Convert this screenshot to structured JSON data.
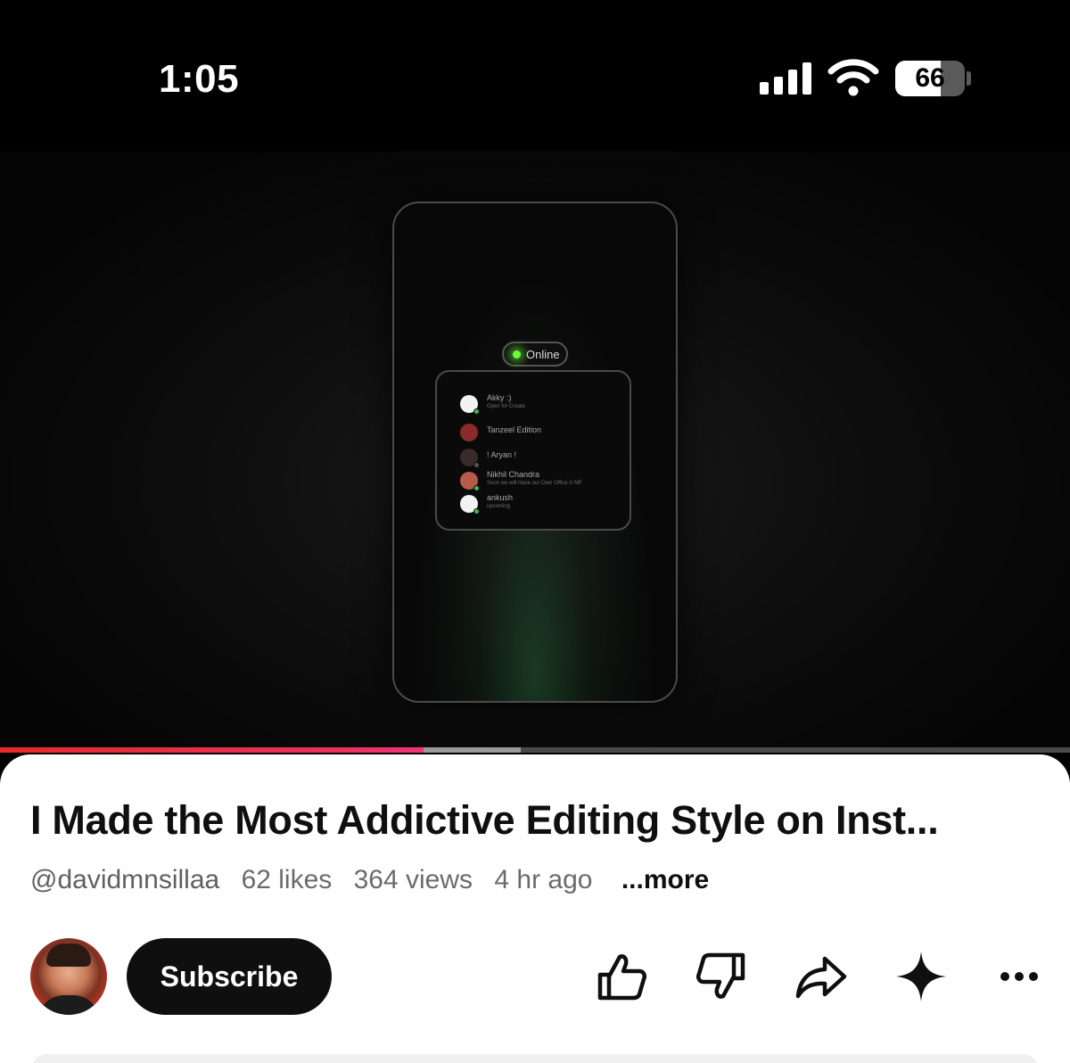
{
  "status_bar": {
    "time": "1:05",
    "battery_level": "66",
    "signal_icon": "cellular-signal-icon",
    "wifi_icon": "wifi-icon",
    "battery_icon": "battery-icon"
  },
  "video": {
    "online_label": "Online",
    "friends": [
      {
        "name": "Akky :)",
        "status": "Open for Create"
      },
      {
        "name": "Tanzeel Edition",
        "status": ""
      },
      {
        "name": "! Aryan !",
        "status": ""
      },
      {
        "name": "Nikhil Chandra",
        "status": "Soon we will Have our Own Office U MF"
      },
      {
        "name": "ankush",
        "status": "upcoming"
      }
    ],
    "progress_played": 0.396,
    "progress_buffered": 0.487
  },
  "info": {
    "title": "I Made the Most Addictive Editing Style on Inst...",
    "channel_handle": "@davidmnsillaa",
    "likes": "62 likes",
    "views": "364 views",
    "age": "4 hr ago",
    "more_label": "...more",
    "subscribe_label": "Subscribe"
  },
  "actions": [
    {
      "icon": "thumbs-up-icon"
    },
    {
      "icon": "thumbs-down-icon"
    },
    {
      "icon": "share-icon"
    },
    {
      "icon": "sparkle-icon"
    },
    {
      "icon": "more-options-icon"
    }
  ],
  "colors": {
    "progress_red": "#e62a2a",
    "progress_pink": "#f0357a",
    "online_green": "#6bff3a",
    "text_primary": "#0f0f0f",
    "text_secondary": "#6b6b6b"
  }
}
